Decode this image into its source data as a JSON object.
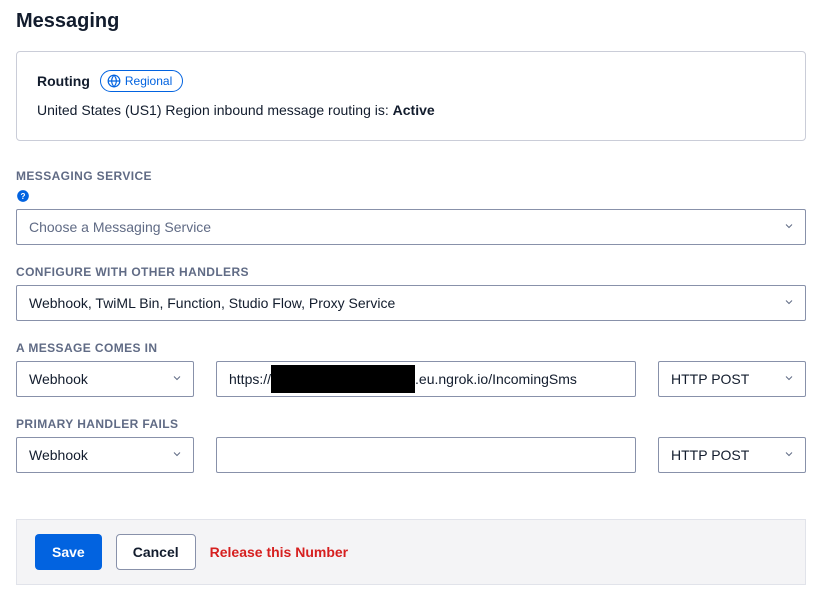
{
  "page": {
    "title": "Messaging"
  },
  "routing": {
    "label": "Routing",
    "badge": "Regional",
    "desc_prefix": "United States (US1) Region inbound message routing is: ",
    "desc_status": "Active"
  },
  "messaging_service": {
    "label": "MESSAGING SERVICE",
    "placeholder": "Choose a Messaging Service"
  },
  "configure_handlers": {
    "label": "CONFIGURE WITH OTHER HANDLERS",
    "value": "Webhook, TwiML Bin, Function, Studio Flow, Proxy Service"
  },
  "message_in": {
    "label": "A MESSAGE COMES IN",
    "handler": "Webhook",
    "url_prefix": "https://",
    "url_suffix": ".eu.ngrok.io/IncomingSms",
    "method": "HTTP POST"
  },
  "primary_fail": {
    "label": "PRIMARY HANDLER FAILS",
    "handler": "Webhook",
    "url": "",
    "method": "HTTP POST"
  },
  "buttons": {
    "save": "Save",
    "cancel": "Cancel",
    "release": "Release this Number"
  },
  "icons": {
    "globe": "globe-icon",
    "help": "help-icon",
    "chevron": "chevron-down-icon"
  }
}
